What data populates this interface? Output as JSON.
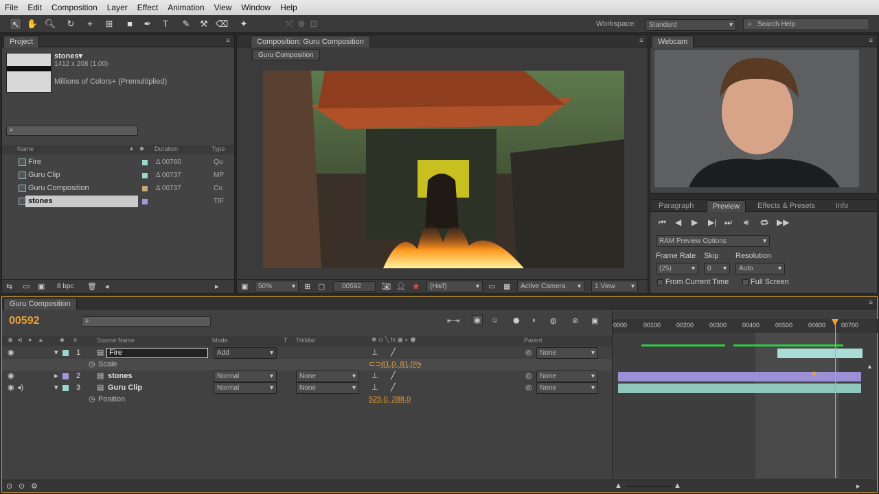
{
  "menu": [
    "File",
    "Edit",
    "Composition",
    "Layer",
    "Effect",
    "Animation",
    "View",
    "Window",
    "Help"
  ],
  "workspace": {
    "label": "Workspace:",
    "value": "Standard",
    "search_placeholder": "Search Help"
  },
  "project": {
    "tab": "Project",
    "item_name": "stones▾",
    "item_dims": "1412 x 208 (1,00)",
    "item_colors": "Millions of Colors+ (Premultiplied)",
    "columns": {
      "name": "Name",
      "duration": "Duration",
      "type": "Type"
    },
    "rows": [
      {
        "name": "Fire",
        "duration": "Δ 00760",
        "type": "Qu",
        "color": "#9dd5cf"
      },
      {
        "name": "Guru Clip",
        "duration": "Δ 00737",
        "type": "MP",
        "color": "#9dd5cf"
      },
      {
        "name": "Guru Composition",
        "duration": "Δ 00737",
        "type": "Co",
        "color": "#c8a876"
      },
      {
        "name": "stones",
        "duration": "",
        "type": "TIF",
        "color": "#a796d9"
      }
    ],
    "bpc": "8 bpc"
  },
  "composition": {
    "tab": "Composition: Guru Composition",
    "subtab": "Guru Composition",
    "zoom": "50%",
    "timecode": "00592",
    "resolution": "(Half)",
    "camera": "Active Camera",
    "view": "1 View"
  },
  "webcam": {
    "tab": "Webcam"
  },
  "preview": {
    "tabs": [
      "Paragraph",
      "Preview",
      "Effects & Presets",
      "Info"
    ],
    "ram_options": "RAM Preview Options",
    "frame_rate_label": "Frame Rate",
    "skip_label": "Skip",
    "resolution_label": "Resolution",
    "frame_rate": "(25)",
    "skip": "0",
    "resolution": "Auto",
    "from_current": "From Current Time",
    "full_screen": "Full Screen"
  },
  "timeline": {
    "tab": "Guru Composition",
    "current_time": "00592",
    "columns": {
      "source": "Source Name",
      "mode": "Mode",
      "t": "T",
      "trkmat": "TrkMat",
      "parent": "Parent"
    },
    "ruler": [
      "0000",
      "00100",
      "00200",
      "00300",
      "00400",
      "00500",
      "00600",
      "00700"
    ],
    "layers": [
      {
        "num": "1",
        "name": "Fire",
        "mode": "Add",
        "trkmat": "",
        "parent": "None",
        "color": "#9dd5cf"
      },
      {
        "num": "2",
        "name": "stones",
        "mode": "Normal",
        "trkmat": "None",
        "parent": "None",
        "color": "#a796d9"
      },
      {
        "num": "3",
        "name": "Guru Clip",
        "mode": "Normal",
        "trkmat": "None",
        "parent": "None",
        "color": "#9dd5cf"
      }
    ],
    "scale_label": "Scale",
    "scale_value": "81,0, 81,0%",
    "position_label": "Position",
    "position_value": "525,0, 288,0",
    "playhead_fraction": 0.84
  },
  "colors": {
    "accent": "#e8a23a",
    "purple_bar": "#9b8fd6",
    "teal_bar": "#8fc7bd"
  }
}
